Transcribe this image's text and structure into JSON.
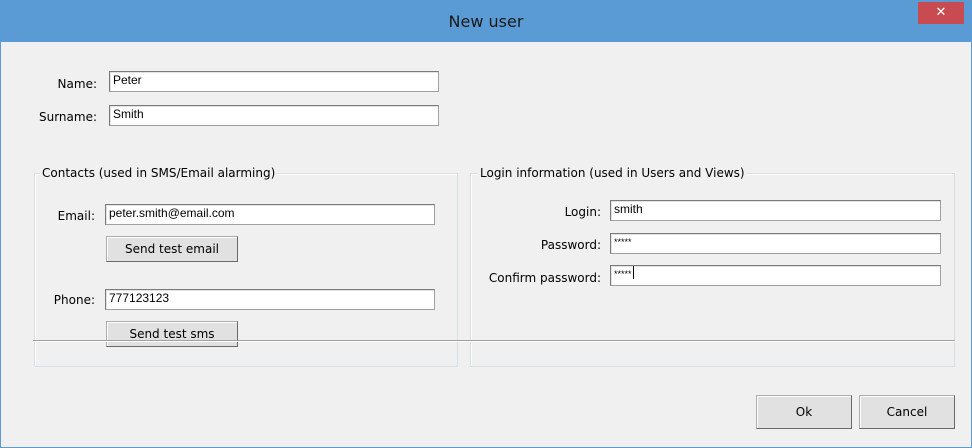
{
  "window": {
    "title": "New user",
    "close_symbol": "✕"
  },
  "name": {
    "label": "Name:",
    "value": "Peter"
  },
  "surname": {
    "label": "Surname:",
    "value": "Smith"
  },
  "contacts": {
    "group_label": "Contacts (used in SMS/Email alarming)",
    "email_label": "Email:",
    "email_value": "peter.smith@email.com",
    "send_email_button": "Send test email",
    "phone_label": "Phone:",
    "phone_value": "777123123",
    "send_sms_button": "Send test sms"
  },
  "login": {
    "group_label": "Login information (used in Users and Views)",
    "login_label": "Login:",
    "login_value": "smith",
    "password_label": "Password:",
    "password_value": "*****",
    "confirm_label": "Confirm password:",
    "confirm_value": "*****"
  },
  "buttons": {
    "ok": "Ok",
    "cancel": "Cancel"
  }
}
